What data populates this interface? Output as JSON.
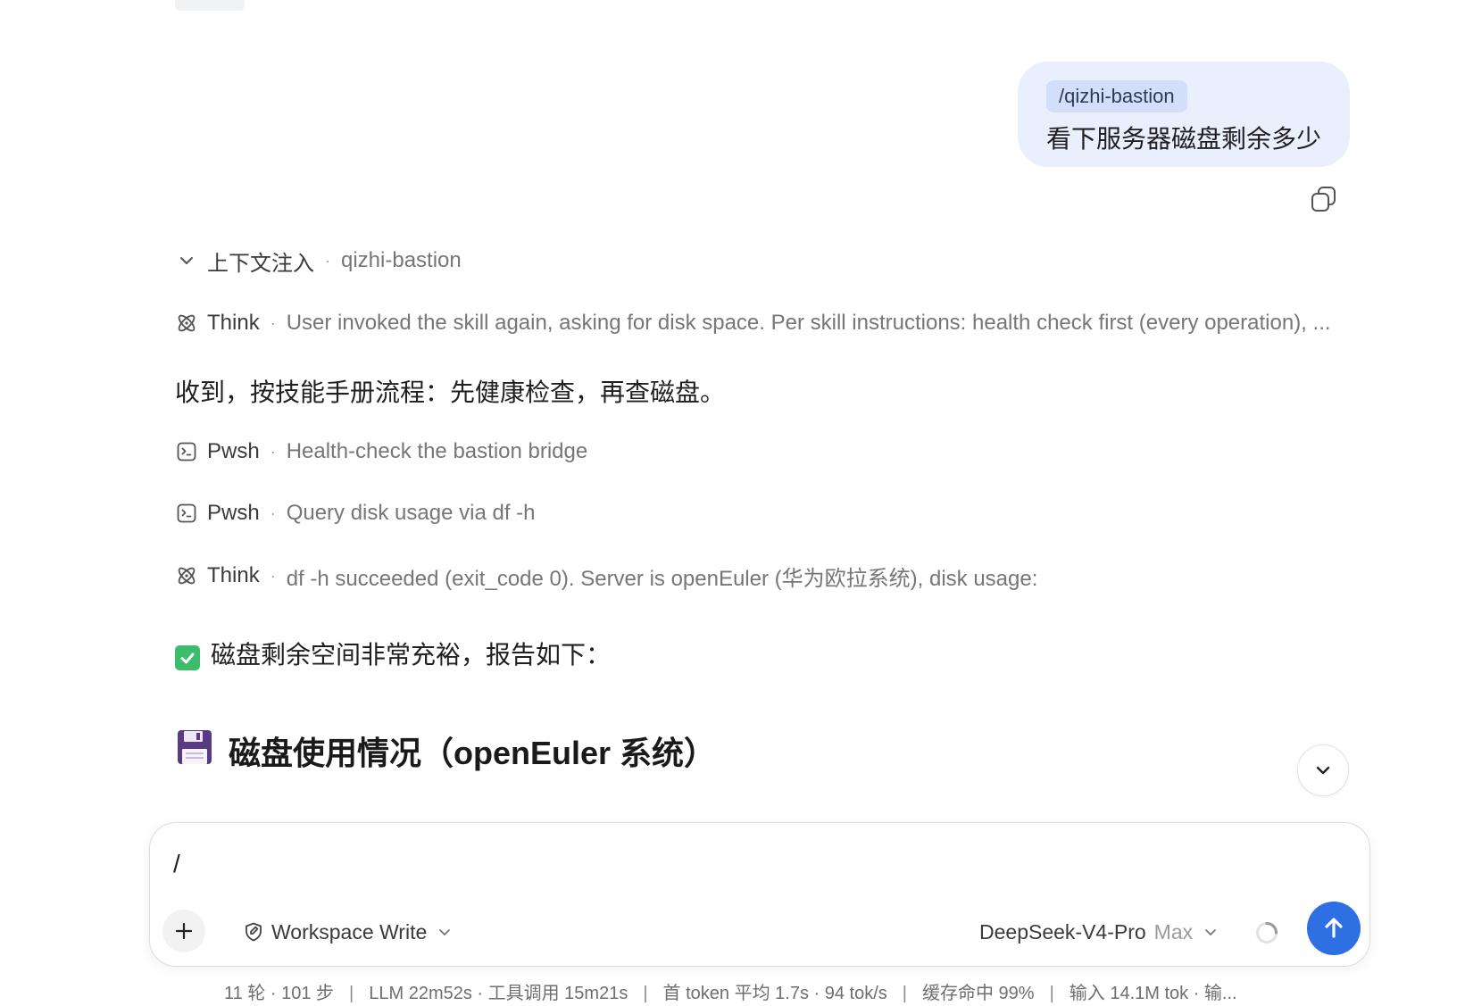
{
  "user_message": {
    "skill_tag": "/qizhi-bastion",
    "text": "看下服务器磁盘剩余多少"
  },
  "context_injection": {
    "label": "上下文注入",
    "skill": "qizhi-bastion"
  },
  "steps": [
    {
      "kind": "Think",
      "desc": "User invoked the skill again, asking for disk space. Per skill instructions: health check first (every operation), ..."
    },
    {
      "kind": "Pwsh",
      "desc": "Health-check the bastion bridge"
    },
    {
      "kind": "Pwsh",
      "desc": "Query disk usage via df -h"
    },
    {
      "kind": "Think",
      "desc": "df -h succeeded (exit_code 0). Server is openEuler (华为欧拉系统), disk usage:"
    }
  ],
  "assistant": {
    "intro": "收到，按技能手册流程：先健康检查，再查磁盘。",
    "summary": "磁盘剩余空间非常充裕，报告如下：",
    "heading": "磁盘使用情况（openEuler 系统）"
  },
  "composer": {
    "input_value": "/",
    "mode": "Workspace Write",
    "model": "DeepSeek-V4-Pro",
    "model_tier": "Max"
  },
  "stats": {
    "rounds": "11 轮 · 101 步",
    "timing": "LLM 22m52s · 工具调用 15m21s",
    "first_token": "首 token 平均 1.7s · 94 tok/s",
    "cache": "缓存命中 99%",
    "input": "输入 14.1M tok · 输..."
  },
  "colors": {
    "accent": "#2f6fe4",
    "user_bubble": "#e9effd",
    "skill_tag_bg": "#d3dffa",
    "check_green": "#3bbd6b"
  }
}
